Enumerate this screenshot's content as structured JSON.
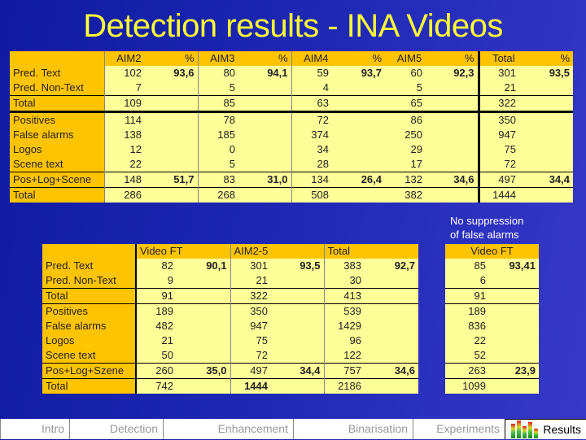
{
  "title": "Detection results - INA Videos",
  "table1": {
    "headers": [
      "",
      "AIM2",
      "%",
      "AIM3",
      "%",
      "AIM4",
      "%",
      "AIM5",
      "%",
      "Total",
      "%"
    ],
    "rows": [
      {
        "label": "Pred. Text",
        "cells": [
          "102",
          "93,6",
          "80",
          "94,1",
          "59",
          "93,7",
          "60",
          "92,3",
          "301",
          "93,5"
        ]
      },
      {
        "label": "Pred. Non-Text",
        "cells": [
          "7",
          "",
          "5",
          "",
          "4",
          "",
          "5",
          "",
          "21",
          ""
        ]
      },
      {
        "label": "Total",
        "cells": [
          "109",
          "",
          "85",
          "",
          "63",
          "",
          "65",
          "",
          "322",
          ""
        ]
      },
      {
        "label": "Positives",
        "cells": [
          "114",
          "",
          "78",
          "",
          "72",
          "",
          "86",
          "",
          "350",
          ""
        ]
      },
      {
        "label": "False alarms",
        "cells": [
          "138",
          "",
          "185",
          "",
          "374",
          "",
          "250",
          "",
          "947",
          ""
        ]
      },
      {
        "label": "Logos",
        "cells": [
          "12",
          "",
          "0",
          "",
          "34",
          "",
          "29",
          "",
          "75",
          ""
        ]
      },
      {
        "label": "Scene text",
        "cells": [
          "22",
          "",
          "5",
          "",
          "28",
          "",
          "17",
          "",
          "72",
          ""
        ]
      },
      {
        "label": "Pos+Log+Scene",
        "cells": [
          "148",
          "51,7",
          "83",
          "31,0",
          "134",
          "26,4",
          "132",
          "34,6",
          "497",
          "34,4"
        ]
      },
      {
        "label": "Total",
        "cells": [
          "286",
          "",
          "268",
          "",
          "508",
          "",
          "382",
          "",
          "1444",
          ""
        ]
      }
    ]
  },
  "note": {
    "line1": "No suppression",
    "line2": "of false alarms"
  },
  "table2": {
    "headers": [
      "",
      "Video FT",
      "AIM2-5",
      "Total"
    ],
    "rows": [
      {
        "label": "Pred. Text",
        "cells": [
          "82",
          "90,1",
          "301",
          "93,5",
          "383",
          "92,7"
        ]
      },
      {
        "label": "Pred. Non-Text",
        "cells": [
          "9",
          "",
          "21",
          "",
          "30",
          ""
        ]
      },
      {
        "label": "Total",
        "cells": [
          "91",
          "",
          "322",
          "",
          "413",
          ""
        ]
      },
      {
        "label": "Positives",
        "cells": [
          "189",
          "",
          "350",
          "",
          "539",
          ""
        ]
      },
      {
        "label": "False alarms",
        "cells": [
          "482",
          "",
          "947",
          "",
          "1429",
          ""
        ]
      },
      {
        "label": "Logos",
        "cells": [
          "21",
          "",
          "75",
          "",
          "96",
          ""
        ]
      },
      {
        "label": "Scene text",
        "cells": [
          "50",
          "",
          "72",
          "",
          "122",
          ""
        ]
      },
      {
        "label": "Pos+Log+Szene",
        "cells": [
          "260",
          "35,0",
          "497",
          "34,4",
          "757",
          "34,6"
        ]
      },
      {
        "label": "Total",
        "cells": [
          "742",
          "",
          "1444",
          "",
          "2186",
          ""
        ]
      }
    ]
  },
  "table3": {
    "header": "Video FT",
    "rows": [
      [
        "85",
        "93,41"
      ],
      [
        "6",
        ""
      ],
      [
        "91",
        ""
      ],
      [
        "189",
        ""
      ],
      [
        "836",
        ""
      ],
      [
        "22",
        ""
      ],
      [
        "52",
        ""
      ],
      [
        "263",
        "23,9"
      ],
      [
        "1099",
        ""
      ]
    ]
  },
  "footer": {
    "tabs": [
      "Intro",
      "Detection",
      "Enhancement",
      "Binarisation",
      "Experiments",
      "Results"
    ],
    "active_tab": "Results",
    "active_icon": "equalizer-icon"
  }
}
